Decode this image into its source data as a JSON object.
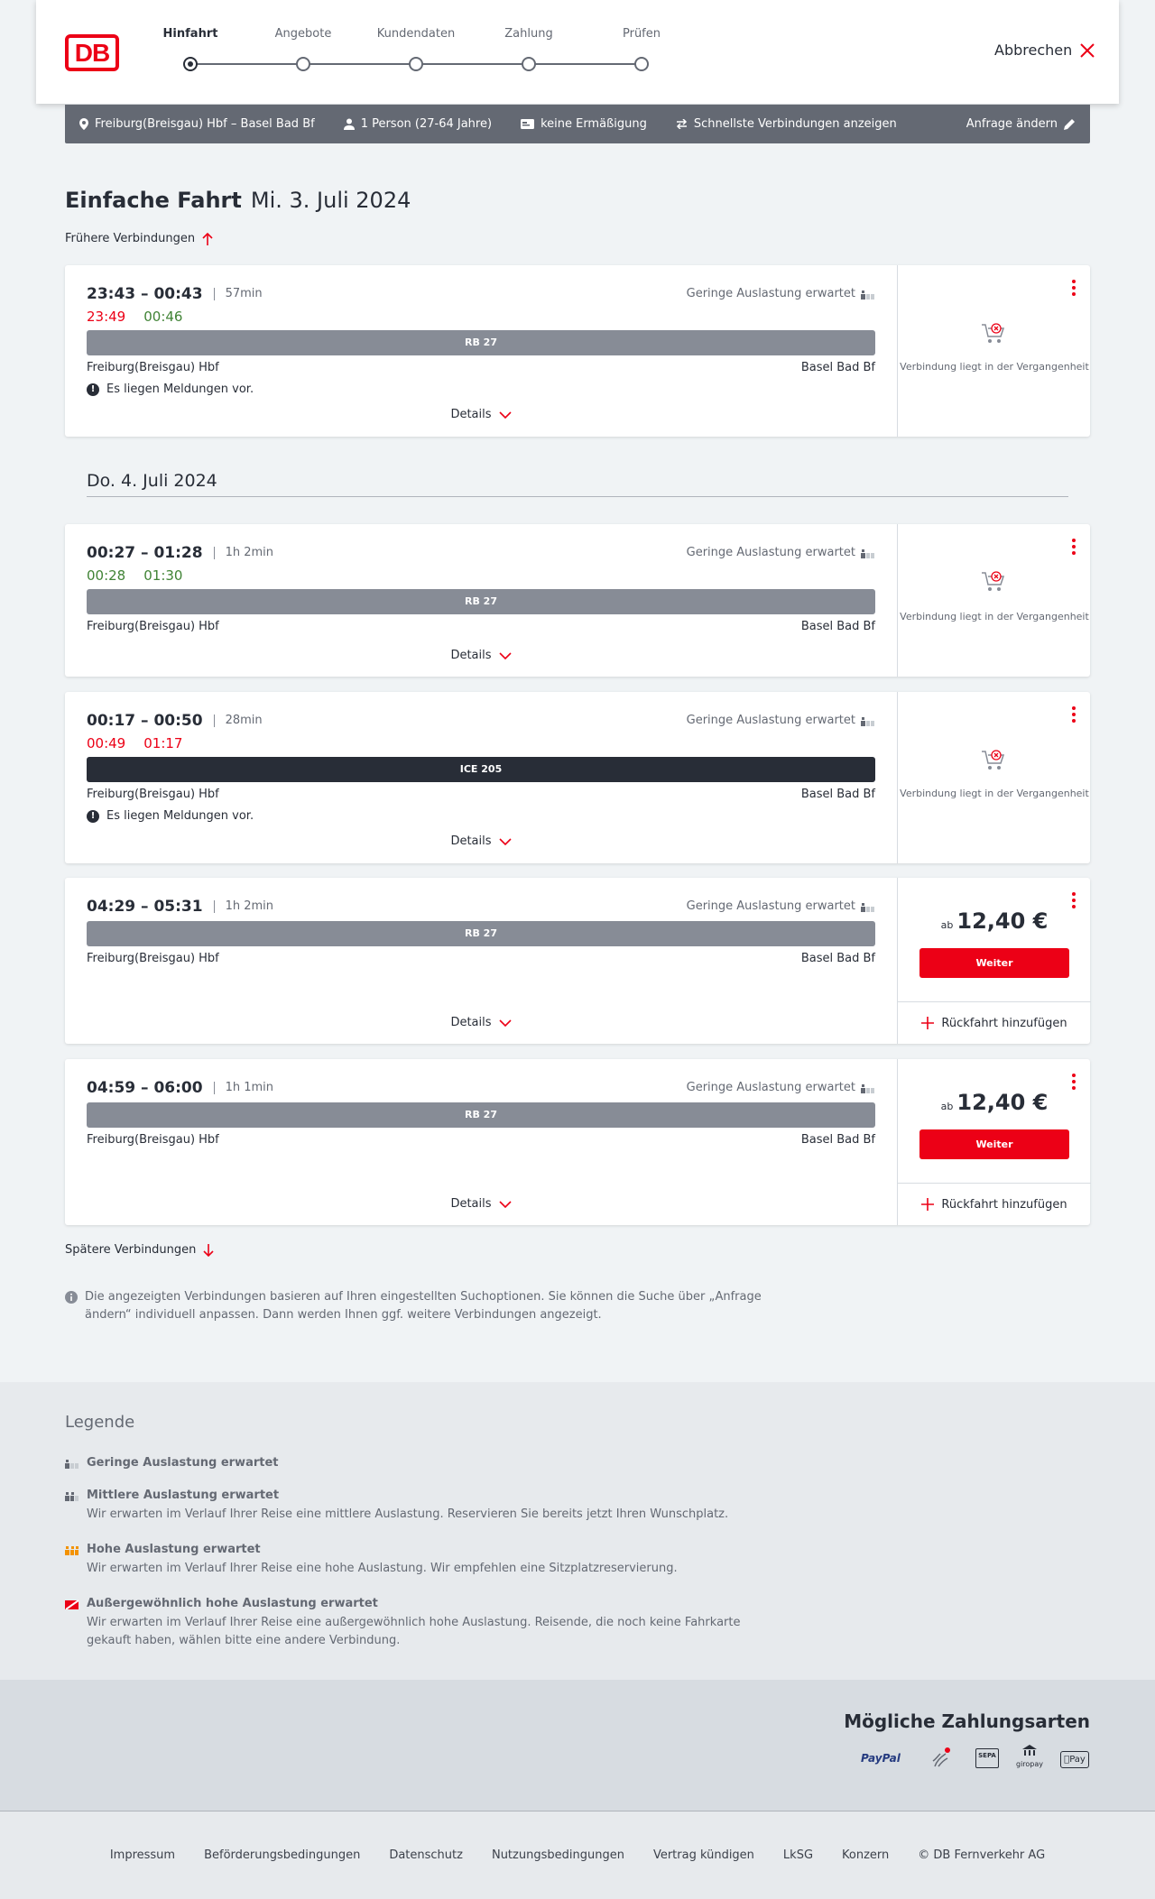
{
  "header": {
    "logo": "DB",
    "steps": [
      "Hinfahrt",
      "Angebote",
      "Kundendaten",
      "Zahlung",
      "Prüfen"
    ],
    "cancel_label": "Abbrechen"
  },
  "searchbar": {
    "route": "Freiburg(Breisgau) Hbf – Basel Bad Bf",
    "passengers": "1 Person (27-64 Jahre)",
    "discount": "keine Ermäßigung",
    "fastest": "Schnellste Verbindungen anzeigen",
    "edit": "Anfrage ändern"
  },
  "title": {
    "type": "Einfache Fahrt",
    "date": "Mi. 3. Juli 2024"
  },
  "earlier": "Frühere Verbindungen",
  "later": "Spätere Verbindungen",
  "day2": "Do. 4. Juli 2024",
  "occupancy_label": "Geringe Auslastung erwartet",
  "details_label": "Details",
  "past_label": "Verbindung liegt in der Vergangenheit",
  "price_prefix": "ab",
  "weiter_label": "Weiter",
  "return_label": "Rückfahrt hinzufügen",
  "messages_label": "Es liegen Meldungen vor.",
  "from": "Freiburg(Breisgau) Hbf",
  "to": "Basel Bad Bf",
  "connections": [
    {
      "times": "23:43 – 00:43",
      "duration": "57min",
      "rt_dep": "23:49",
      "rt_arr": "00:46",
      "train": "RB 27"
    },
    {
      "times": "00:27 – 01:28",
      "duration": "1h 2min",
      "rt_dep": "00:28",
      "rt_arr": "01:30",
      "train": "RB 27"
    },
    {
      "times": "00:17 – 00:50",
      "duration": "28min",
      "rt_dep": "00:49",
      "rt_arr": "01:17",
      "train": "ICE 205"
    },
    {
      "times": "04:29 – 05:31",
      "duration": "1h 2min",
      "train": "RB 27",
      "price": "12,40 €"
    },
    {
      "times": "04:59 – 06:00",
      "duration": "1h 1min",
      "train": "RB 27",
      "price": "12,40 €"
    }
  ],
  "info_text": "Die angezeigten Verbindungen basieren auf Ihren eingestellten Suchoptionen. Sie können die Suche über „Anfrage ändern“ individuell anpassen. Dann werden Ihnen ggf. weitere Verbindungen angezeigt.",
  "legend": {
    "title": "Legende",
    "items": [
      {
        "title": "Geringe Auslastung erwartet",
        "text": ""
      },
      {
        "title": "Mittlere Auslastung erwartet",
        "text": "Wir erwarten im Verlauf Ihrer Reise eine mittlere Auslastung. Reservieren Sie bereits jetzt Ihren Wunschplatz."
      },
      {
        "title": "Hohe Auslastung erwartet",
        "text": "Wir erwarten im Verlauf Ihrer Reise eine hohe Auslastung. Wir empfehlen eine Sitzplatzreservierung."
      },
      {
        "title": "Außergewöhnlich hohe Auslastung erwartet",
        "text": "Wir erwarten im Verlauf Ihrer Reise eine außergewöhnlich hohe Auslastung. Reisende, die noch keine Fahrkarte gekauft haben, wählen bitte eine andere Verbindung."
      }
    ]
  },
  "payment": {
    "title": "Mögliche Zahlungsarten",
    "paypal": "PayPal",
    "sepa": "SEPA",
    "giropay": "giropay",
    "applepay": "Pay"
  },
  "footer": [
    "Impressum",
    "Beförderungsbedingungen",
    "Datenschutz",
    "Nutzungsbedingungen",
    "Vertrag kündigen",
    "LkSG",
    "Konzern",
    "© DB Fernverkehr AG"
  ],
  "colors": {
    "red": "#ec0016",
    "green": "#408335",
    "dark": "#282d37",
    "grey": "#646973"
  }
}
